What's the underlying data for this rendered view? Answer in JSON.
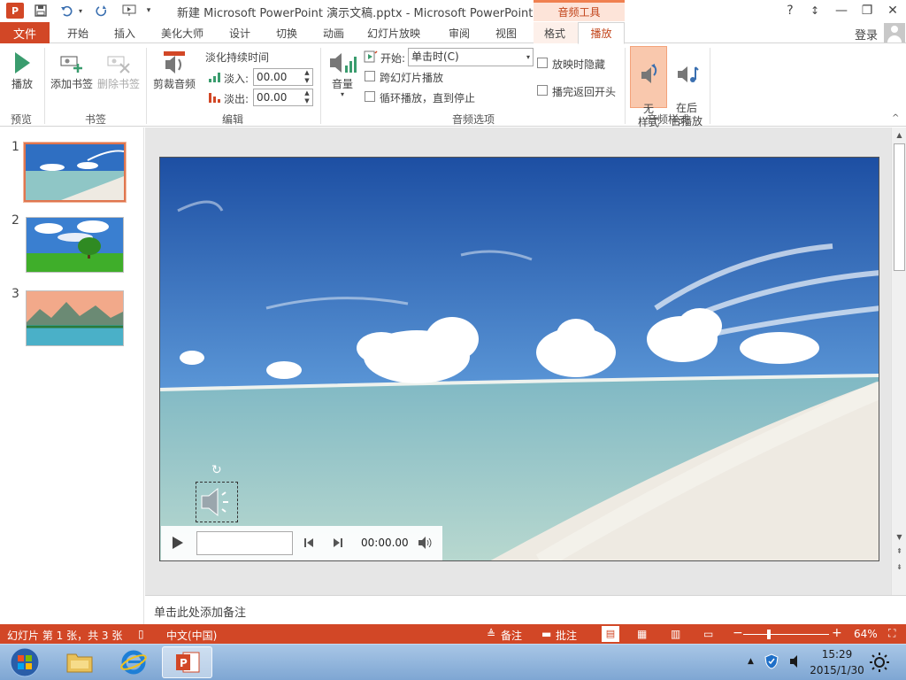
{
  "app": {
    "logo_text": "P",
    "document_title": "新建 Microsoft PowerPoint 演示文稿.pptx - Microsoft PowerPoint",
    "contextual_tab_group": "音频工具",
    "window_buttons": [
      "?",
      "↕",
      "—",
      "❐",
      "✕"
    ]
  },
  "tabs": {
    "file": "文件",
    "items": [
      "开始",
      "插入",
      "美化大师",
      "设计",
      "切换",
      "动画",
      "幻灯片放映",
      "审阅",
      "视图",
      "格式",
      "播放"
    ],
    "active": "播放",
    "login": "登录"
  },
  "ribbon": {
    "preview": {
      "play": "播放",
      "group": "预览"
    },
    "bookmarks": {
      "add": "添加书签",
      "remove": "删除书签",
      "group": "书签"
    },
    "editing": {
      "trim": "剪裁音频",
      "fade_title": "淡化持续时间",
      "fade_in_label": "淡入:",
      "fade_in_value": "00.00",
      "fade_out_label": "淡出:",
      "fade_out_value": "00.00",
      "group": "编辑"
    },
    "audio_options": {
      "volume": "音量",
      "start_label": "开始:",
      "start_value": "单击时(C)",
      "play_across_slides": "跨幻灯片播放",
      "loop_until_stopped": "循环播放，直到停止",
      "hide_during_show": "放映时隐藏",
      "rewind_after_playing": "播完返回开头",
      "group": "音频选项"
    },
    "audio_styles": {
      "no_style": "无\n样式",
      "play_in_background": "在后\n台播放",
      "group": "音频样式"
    }
  },
  "slides": [
    {
      "number": "1",
      "selected": true
    },
    {
      "number": "2",
      "selected": false
    },
    {
      "number": "3",
      "selected": false
    }
  ],
  "audio_player": {
    "time": "00:00.00"
  },
  "notes": {
    "placeholder": "单击此处添加备注"
  },
  "status": {
    "slide_info": "幻灯片 第 1 张，共 3 张",
    "language": "中文(中国)",
    "notes": "备注",
    "comments": "批注",
    "zoom": "64%",
    "zoom_level": 0.64
  },
  "taskbar": {
    "time": "15:29",
    "date": "2015/1/30"
  },
  "colors": {
    "accent": "#d24726",
    "sky": "#2a64b8",
    "sea": "#8fc6c6",
    "sand": "#eeeae2"
  }
}
